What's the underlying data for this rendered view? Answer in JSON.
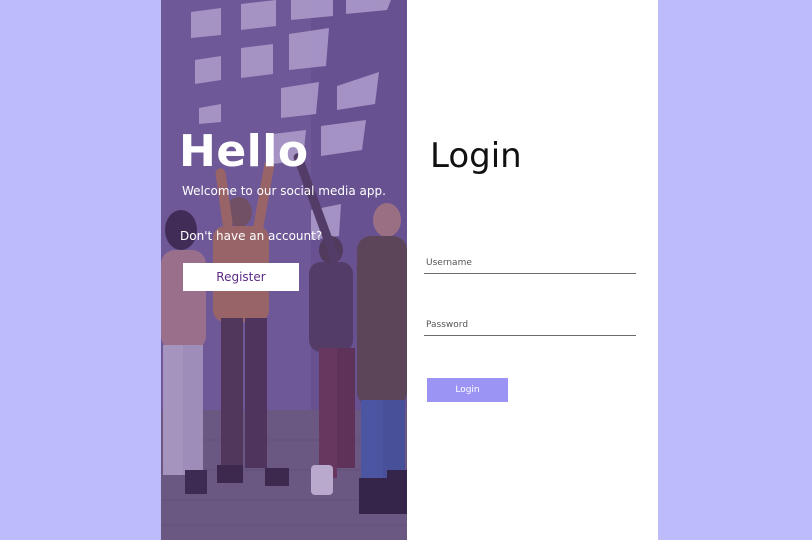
{
  "left_panel": {
    "heading": "Hello",
    "welcome": "Welcome to our social media app.",
    "prompt": "Don't have an account?",
    "register_label": "Register"
  },
  "right_panel": {
    "title": "Login",
    "username_placeholder": "Username",
    "password_placeholder": "Password",
    "login_label": "Login"
  },
  "colors": {
    "page_background": "#bdbbf9",
    "overlay": "#623c96",
    "login_button": "#9b94f5",
    "register_text": "#5b2a86"
  }
}
